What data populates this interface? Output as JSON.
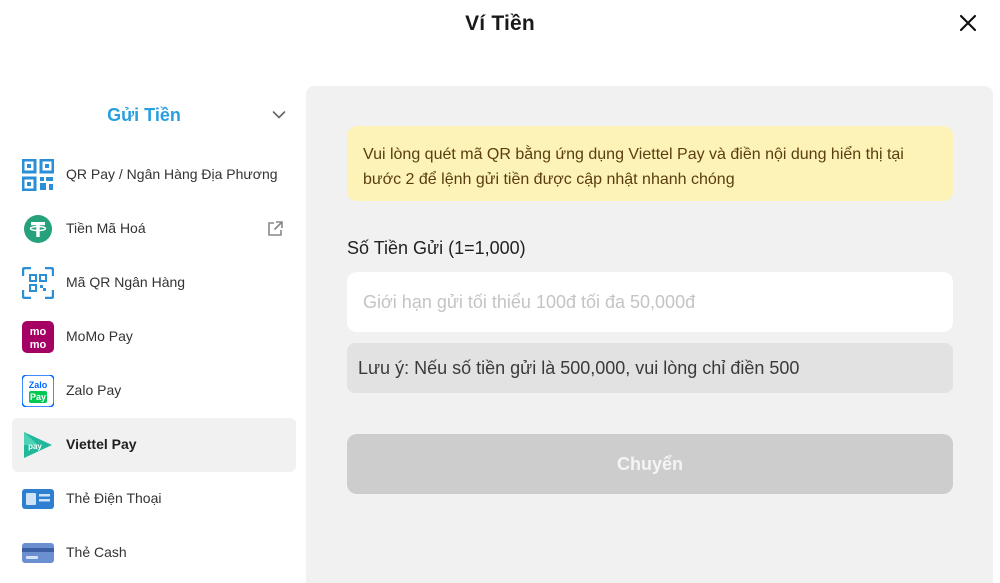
{
  "header": {
    "title": "Ví Tiền"
  },
  "sidebar": {
    "section_title": "Gửi Tiền",
    "items": [
      {
        "label": "QR Pay / Ngân Hàng Địa Phương",
        "icon": "qr-code-icon"
      },
      {
        "label": "Tiền Mã Hoá",
        "icon": "tether-icon",
        "external": true
      },
      {
        "label": "Mã QR Ngân Hàng",
        "icon": "bank-qr-icon"
      },
      {
        "label": "MoMo Pay",
        "icon": "momo-icon",
        "icon_text": "mo mo"
      },
      {
        "label": "Zalo Pay",
        "icon": "zalopay-icon",
        "icon_text": "Zalo Pay"
      },
      {
        "label": "Viettel Pay",
        "icon": "viettelpay-icon",
        "icon_text": "pay",
        "active": true
      },
      {
        "label": "Thẻ Điện Thoại",
        "icon": "phone-card-icon"
      },
      {
        "label": "Thẻ Cash",
        "icon": "cash-card-icon"
      }
    ]
  },
  "main": {
    "notice": "Vui lòng quét mã QR bằng ứng dụng Viettel Pay và điền nội dung hiển thị tại bước 2 để lệnh gửi tiền được cập nhật nhanh chóng",
    "amount_label": "Số Tiền Gửi (1=1,000)",
    "amount_value": "",
    "amount_placeholder": "Giới hạn gửi tối thiểu 100đ tối đa 50,000đ",
    "note": "Lưu ý: Nếu số tiền gửi là 500,000, vui lòng chỉ điền 500",
    "submit_label": "Chuyển"
  },
  "colors": {
    "accent": "#2a9fe0",
    "notice_bg": "#fdf3b6",
    "panel_bg": "#f1f1f1",
    "button_disabled": "#cdcdcd"
  }
}
